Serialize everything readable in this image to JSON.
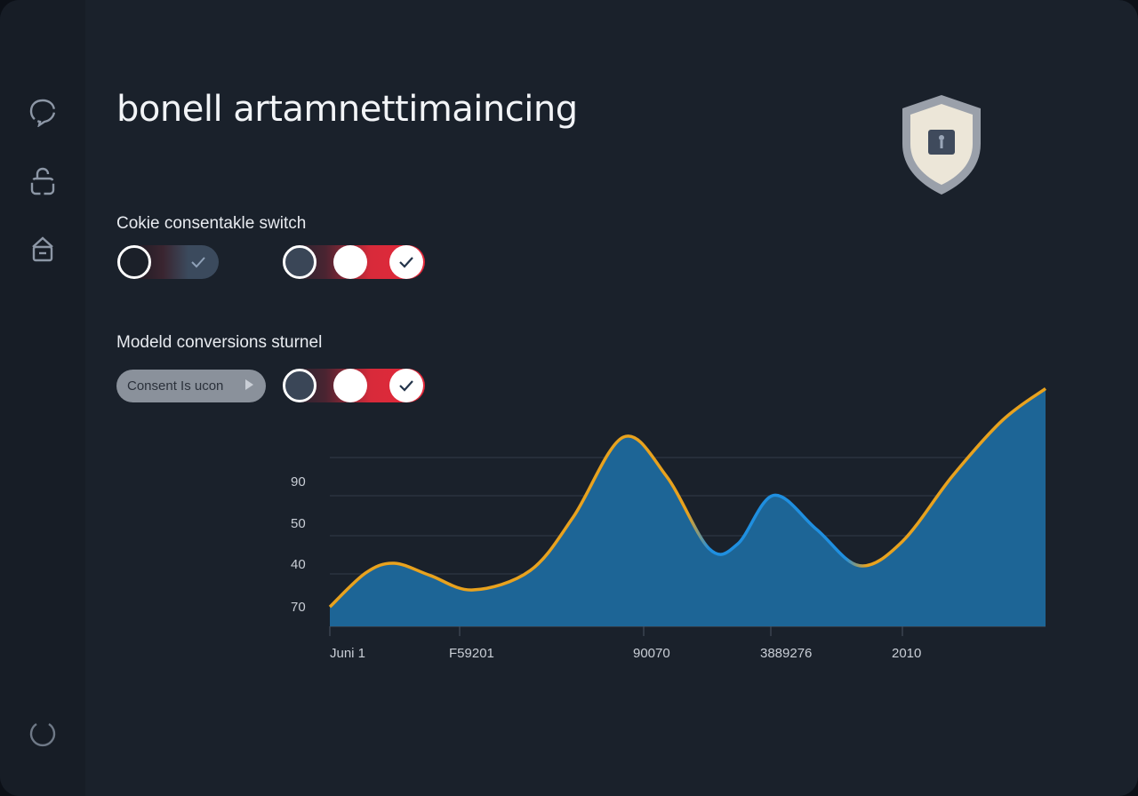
{
  "header": {
    "title": "bonell artamnettimaincing"
  },
  "sidebar": {
    "items": [
      {
        "icon": "chat-bubble-icon"
      },
      {
        "icon": "lock-open-icon"
      },
      {
        "icon": "lock-icon"
      }
    ],
    "footer_icon": "refresh-icon"
  },
  "shield_icon": "shield-lock-icon",
  "sections": {
    "cookie": {
      "label": "Cokie consentakle switch",
      "toggle_1_state": "off",
      "toggle_2_state": "on"
    },
    "conversions": {
      "label": "Modeld conversions sturnel",
      "button_label": "Consent Is ucon",
      "toggle_state": "on"
    }
  },
  "colors": {
    "background": "#1a212b",
    "accent_red": "#e3283a",
    "area_fill": "#1d6596",
    "line_orange": "#e8a21e",
    "line_blue": "#1f8fe0"
  },
  "chart_data": {
    "type": "area",
    "y_tick_labels": [
      "90",
      "50",
      "40",
      "70"
    ],
    "x_tick_labels": [
      "Juni 1",
      "F59201",
      "90070",
      "3889276",
      "2010"
    ],
    "title": "",
    "xlabel": "",
    "ylabel": "",
    "grid": true,
    "series": [
      {
        "values": [
          [
            0.0,
            0.08
          ],
          [
            0.05,
            0.22
          ],
          [
            0.09,
            0.26
          ],
          [
            0.14,
            0.21
          ],
          [
            0.2,
            0.15
          ],
          [
            0.28,
            0.23
          ],
          [
            0.34,
            0.45
          ],
          [
            0.41,
            0.78
          ],
          [
            0.47,
            0.62
          ],
          [
            0.53,
            0.32
          ],
          [
            0.57,
            0.34
          ],
          [
            0.62,
            0.54
          ],
          [
            0.68,
            0.4
          ],
          [
            0.74,
            0.25
          ],
          [
            0.8,
            0.35
          ],
          [
            0.87,
            0.62
          ],
          [
            0.94,
            0.85
          ],
          [
            1.0,
            0.98
          ]
        ]
      }
    ]
  }
}
